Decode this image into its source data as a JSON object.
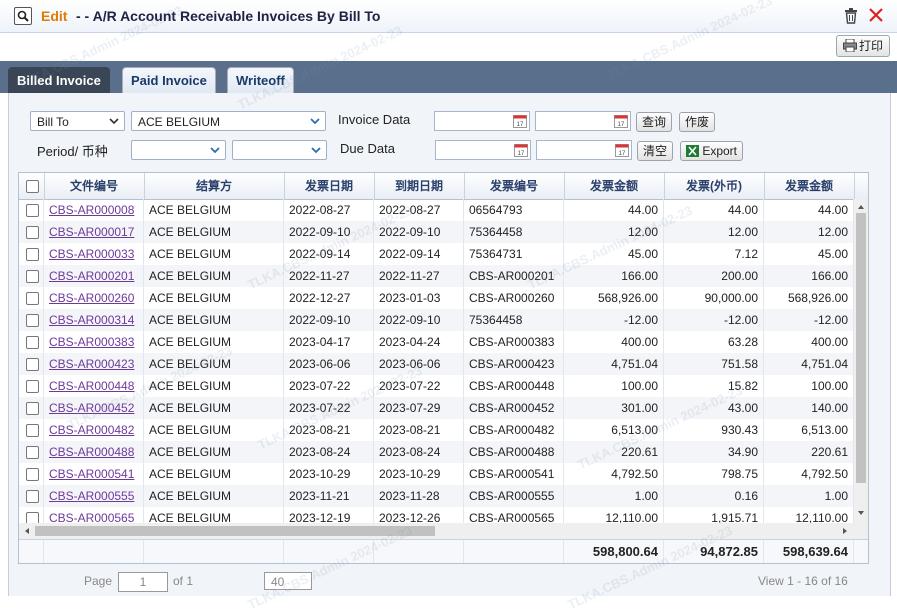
{
  "title": {
    "edit": "Edit",
    "text": "- - A/R Account Receivable Invoices By Bill To"
  },
  "print_label": "打印",
  "watermark": "TLKA.CBS.Admin 2024-02-23",
  "tabs": [
    {
      "label": "Billed Invoice",
      "active": true
    },
    {
      "label": "Paid Invoice",
      "active": false
    },
    {
      "label": "Writeoff",
      "active": false
    }
  ],
  "filters": {
    "bill_to_type": "Bill To",
    "bill_to_value": "ACE BELGIUM",
    "period_label": "Period/ 币种",
    "period_value": "",
    "currency_value": "",
    "invoice_date_label": "Invoice Data",
    "due_date_label": "Due Data",
    "invoice_from": "",
    "invoice_to": "",
    "due_from": "",
    "due_to": "",
    "query_button": "查询",
    "void_button": "作废",
    "clear_button": "清空",
    "export_button": "Export"
  },
  "columns": [
    "文件编号",
    "结算方",
    "发票日期",
    "到期日期",
    "发票编号",
    "发票金额",
    "发票(外币)",
    "发票金额"
  ],
  "rows": [
    {
      "doc": "CBS-AR000008",
      "party": "ACE BELGIUM",
      "inv_date": "2022-08-27",
      "due_date": "2022-08-27",
      "inv_no": "06564793",
      "amount": "44.00",
      "foreign": "44.00",
      "amount2": "44.00"
    },
    {
      "doc": "CBS-AR000017",
      "party": "ACE BELGIUM",
      "inv_date": "2022-09-10",
      "due_date": "2022-09-10",
      "inv_no": "75364458",
      "amount": "12.00",
      "foreign": "12.00",
      "amount2": "12.00"
    },
    {
      "doc": "CBS-AR000033",
      "party": "ACE BELGIUM",
      "inv_date": "2022-09-14",
      "due_date": "2022-09-14",
      "inv_no": "75364731",
      "amount": "45.00",
      "foreign": "7.12",
      "amount2": "45.00"
    },
    {
      "doc": "CBS-AR000201",
      "party": "ACE BELGIUM",
      "inv_date": "2022-11-27",
      "due_date": "2022-11-27",
      "inv_no": "CBS-AR000201",
      "amount": "166.00",
      "foreign": "200.00",
      "amount2": "166.00"
    },
    {
      "doc": "CBS-AR000260",
      "party": "ACE BELGIUM",
      "inv_date": "2022-12-27",
      "due_date": "2023-01-03",
      "inv_no": "CBS-AR000260",
      "amount": "568,926.00",
      "foreign": "90,000.00",
      "amount2": "568,926.00"
    },
    {
      "doc": "CBS-AR000314",
      "party": "ACE BELGIUM",
      "inv_date": "2022-09-10",
      "due_date": "2022-09-10",
      "inv_no": "75364458",
      "amount": "-12.00",
      "foreign": "-12.00",
      "amount2": "-12.00"
    },
    {
      "doc": "CBS-AR000383",
      "party": "ACE BELGIUM",
      "inv_date": "2023-04-17",
      "due_date": "2023-04-24",
      "inv_no": "CBS-AR000383",
      "amount": "400.00",
      "foreign": "63.28",
      "amount2": "400.00"
    },
    {
      "doc": "CBS-AR000423",
      "party": "ACE BELGIUM",
      "inv_date": "2023-06-06",
      "due_date": "2023-06-06",
      "inv_no": "CBS-AR000423",
      "amount": "4,751.04",
      "foreign": "751.58",
      "amount2": "4,751.04"
    },
    {
      "doc": "CBS-AR000448",
      "party": "ACE BELGIUM",
      "inv_date": "2023-07-22",
      "due_date": "2023-07-22",
      "inv_no": "CBS-AR000448",
      "amount": "100.00",
      "foreign": "15.82",
      "amount2": "100.00"
    },
    {
      "doc": "CBS-AR000452",
      "party": "ACE BELGIUM",
      "inv_date": "2023-07-22",
      "due_date": "2023-07-29",
      "inv_no": "CBS-AR000452",
      "amount": "301.00",
      "foreign": "43.00",
      "amount2": "140.00"
    },
    {
      "doc": "CBS-AR000482",
      "party": "ACE BELGIUM",
      "inv_date": "2023-08-21",
      "due_date": "2023-08-21",
      "inv_no": "CBS-AR000482",
      "amount": "6,513.00",
      "foreign": "930.43",
      "amount2": "6,513.00"
    },
    {
      "doc": "CBS-AR000488",
      "party": "ACE BELGIUM",
      "inv_date": "2023-08-24",
      "due_date": "2023-08-24",
      "inv_no": "CBS-AR000488",
      "amount": "220.61",
      "foreign": "34.90",
      "amount2": "220.61"
    },
    {
      "doc": "CBS-AR000541",
      "party": "ACE BELGIUM",
      "inv_date": "2023-10-29",
      "due_date": "2023-10-29",
      "inv_no": "CBS-AR000541",
      "amount": "4,792.50",
      "foreign": "798.75",
      "amount2": "4,792.50"
    },
    {
      "doc": "CBS-AR000555",
      "party": "ACE BELGIUM",
      "inv_date": "2023-11-21",
      "due_date": "2023-11-28",
      "inv_no": "CBS-AR000555",
      "amount": "1.00",
      "foreign": "0.16",
      "amount2": "1.00"
    },
    {
      "doc": "CBS-AR000565",
      "party": "ACE BELGIUM",
      "inv_date": "2023-12-19",
      "due_date": "2023-12-26",
      "inv_no": "CBS-AR000565",
      "amount": "12,110.00",
      "foreign": "1,915.71",
      "amount2": "12,110.00"
    }
  ],
  "totals": {
    "amount": "598,800.64",
    "foreign": "94,872.85",
    "amount2": "598,639.64"
  },
  "pager": {
    "page_label": "Page",
    "page_value": "1",
    "of_label": "of 1",
    "page_size": "40",
    "summary": "View 1 - 16 of 16"
  },
  "colors": {
    "accent": "#e07b00",
    "tab_active": "#3a4656",
    "tab_bar": "#5a6f8b",
    "link": "#6e3a9a",
    "close": "#e02020"
  }
}
